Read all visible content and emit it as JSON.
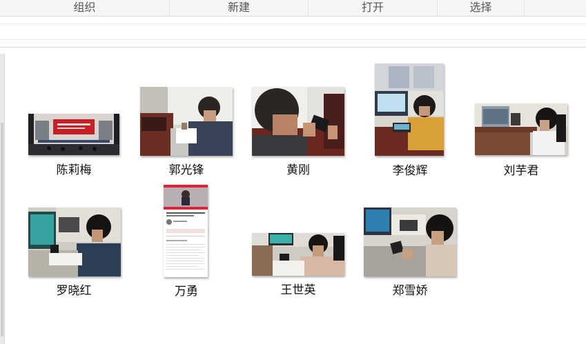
{
  "ribbon": {
    "groups": [
      {
        "label": "组织"
      },
      {
        "label": "新建"
      },
      {
        "label": "打开"
      },
      {
        "label": "选择"
      }
    ]
  },
  "files": [
    {
      "name": "陈莉梅"
    },
    {
      "name": "郭光锋"
    },
    {
      "name": "黄刚"
    },
    {
      "name": "李俊辉"
    },
    {
      "name": "刘芋君"
    },
    {
      "name": "罗晓红"
    },
    {
      "name": "万勇"
    },
    {
      "name": "王世英"
    },
    {
      "name": "郑雪娇"
    }
  ]
}
